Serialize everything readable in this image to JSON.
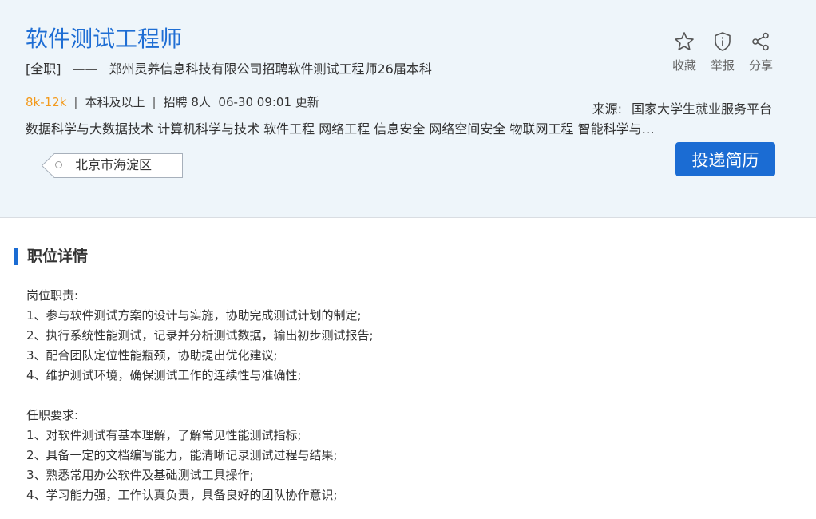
{
  "job": {
    "title": "软件测试工程师",
    "type": "[全职]",
    "dash": "——",
    "company_headline": "郑州灵养信息科技有限公司招聘软件测试工程师26届本科",
    "salary": "8k-12k",
    "sep": "|",
    "education": "本科及以上",
    "headcount": "招聘 8人",
    "updated": "06-30 09:01 更新",
    "majors": "数据科学与大数据技术 计算机科学与技术 软件工程 网络工程 信息安全 网络空间安全 物联网工程 智能科学与技术 电子信息工程",
    "location": "北京市海淀区"
  },
  "source": {
    "label": "来源:",
    "name": "国家大学生就业服务平台"
  },
  "actions": [
    {
      "label": "收藏",
      "icon": "star-icon"
    },
    {
      "label": "举报",
      "icon": "shield-info-icon"
    },
    {
      "label": "分享",
      "icon": "share-icon"
    }
  ],
  "apply_label": "投递简历",
  "details": {
    "section_title": "职位详情",
    "duties_title": "岗位职责:",
    "duties": [
      "1、参与软件测试方案的设计与实施，协助完成测试计划的制定;",
      "2、执行系统性能测试，记录并分析测试数据，输出初步测试报告;",
      "3、配合团队定位性能瓶颈，协助提出优化建议;",
      "4、维护测试环境，确保测试工作的连续性与准确性;"
    ],
    "requirements_title": "任职要求:",
    "requirements": [
      "1、对软件测试有基本理解，了解常见性能测试指标;",
      "2、具备一定的文档编写能力，能清晰记录测试过程与结果;",
      "3、熟悉常用办公软件及基础测试工具操作;",
      "4、学习能力强，工作认真负责，具备良好的团队协作意识;"
    ]
  },
  "colors": {
    "accent": "#1b6cd3",
    "salary": "#f39a1c",
    "header_bg": "#eef5fa"
  }
}
